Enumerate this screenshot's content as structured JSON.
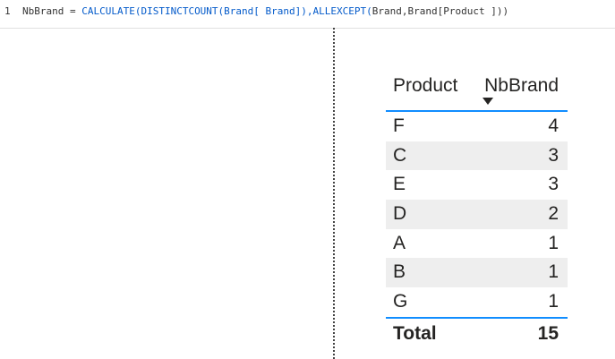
{
  "formula": {
    "line_number": "1",
    "measure_name": "NbBrand =",
    "fn_calculate": "CALCULATE(DISTINCTCOUNT(Brand[ Brand]),",
    "fn_allexcept": "ALLEXCEPT(",
    "args": "Brand,Brand[Product ]))"
  },
  "table": {
    "headers": {
      "product": "Product",
      "nbbrand": "NbBrand"
    },
    "rows": [
      {
        "product": "F",
        "nbbrand": "4"
      },
      {
        "product": "C",
        "nbbrand": "3"
      },
      {
        "product": "E",
        "nbbrand": "3"
      },
      {
        "product": "D",
        "nbbrand": "2"
      },
      {
        "product": "A",
        "nbbrand": "1"
      },
      {
        "product": "B",
        "nbbrand": "1"
      },
      {
        "product": "G",
        "nbbrand": "1"
      }
    ],
    "total": {
      "label": "Total",
      "value": "15"
    }
  },
  "colors": {
    "accent": "#118dff",
    "keyword": "#035aca",
    "row_alt": "#eeeeee",
    "text": "#252423"
  },
  "icons": {
    "sort": "sort-descending-icon"
  }
}
